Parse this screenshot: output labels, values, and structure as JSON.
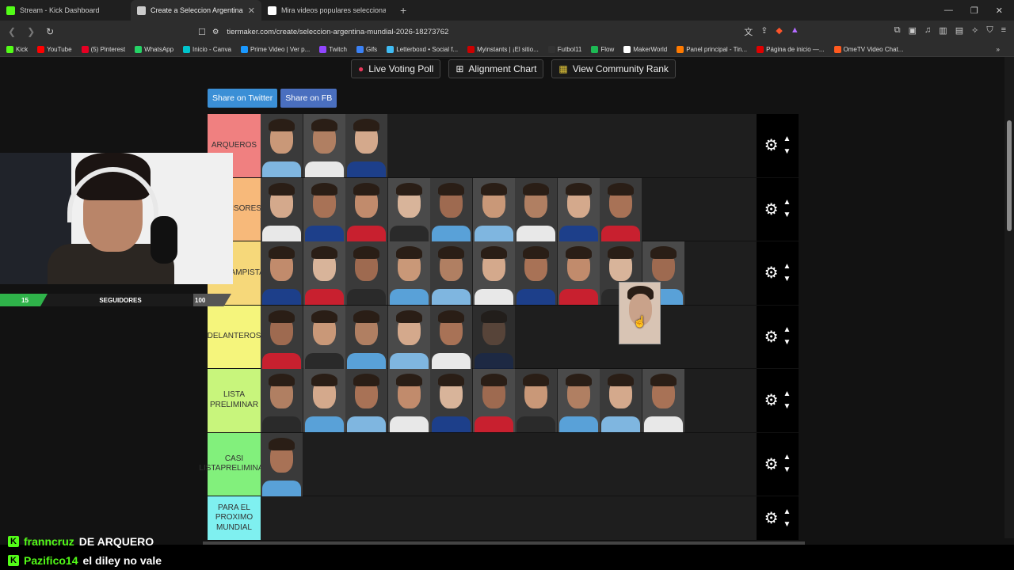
{
  "browser": {
    "tabs": [
      {
        "title": "Stream - Kick Dashboard",
        "favicon_color": "#53fc18"
      },
      {
        "title": "Create a Seleccion Argentina Mu",
        "favicon_color": "#cccccc",
        "active": true
      },
      {
        "title": "Mira videos populares seleccionados",
        "favicon_color": "#ffffff"
      }
    ],
    "new_tab": "+",
    "url": "tiermaker.com/create/seleccion-argentina-mundial-2026-18273762",
    "bookmarks": [
      {
        "label": "Kick",
        "color": "#53fc18"
      },
      {
        "label": "YouTube",
        "color": "#ff0000"
      },
      {
        "label": "(5) Pinterest",
        "color": "#e60023"
      },
      {
        "label": "WhatsApp",
        "color": "#25d366"
      },
      {
        "label": "Inicio - Canva",
        "color": "#00c4cc"
      },
      {
        "label": "Prime Video | Ver p...",
        "color": "#1a98ff"
      },
      {
        "label": "Twitch",
        "color": "#9146ff"
      },
      {
        "label": "Gifs",
        "color": "#3b82f6"
      },
      {
        "label": "Letterboxd • Social f...",
        "color": "#40bcf4"
      },
      {
        "label": "Myinstants | ¡El sitio...",
        "color": "#cc0000"
      },
      {
        "label": "Futbol11",
        "color": "#333333"
      },
      {
        "label": "Flow",
        "color": "#1db954"
      },
      {
        "label": "MakerWorld",
        "color": "#ffffff"
      },
      {
        "label": "Panel principal - Tin...",
        "color": "#ff7a00"
      },
      {
        "label": "Página de inicio —...",
        "color": "#e00000"
      },
      {
        "label": "OmeTV Video Chat...",
        "color": "#ff5a1f"
      }
    ]
  },
  "page": {
    "buttons": {
      "live_voting": "Live Voting Poll",
      "alignment": "Alignment Chart",
      "community_rank": "View Community Rank",
      "share_twitter": "Share on Twitter",
      "share_fb": "Share on FB"
    },
    "tiers": [
      {
        "label": "ARQUEROS",
        "color": "#f08080",
        "players": 3
      },
      {
        "label": "DEFENSORES",
        "color": "#f7b97a",
        "players": 9
      },
      {
        "label": "MEDIOCAMPISTAS",
        "color": "#f6d87a",
        "players": 10
      },
      {
        "label": "DELANTEROS",
        "color": "#f5f57c",
        "players": 6
      },
      {
        "label": "LISTA PRELIMINAR",
        "color": "#c8f57c",
        "players": 10
      },
      {
        "label": "CASI LISTAPRELIMINAR",
        "color": "#82f07c",
        "players": 1
      },
      {
        "label": "PARA EL PROXIMO MUNDIAL",
        "color": "#7ff0f0",
        "players": 0
      }
    ]
  },
  "overlay": {
    "followers_current": "15",
    "followers_label": "SEGUIDORES",
    "followers_goal": "100"
  },
  "chat": [
    {
      "user": "franncruz",
      "message": "DE ARQUERO"
    },
    {
      "user": "Pazifico14",
      "message": "el diley no vale"
    }
  ]
}
